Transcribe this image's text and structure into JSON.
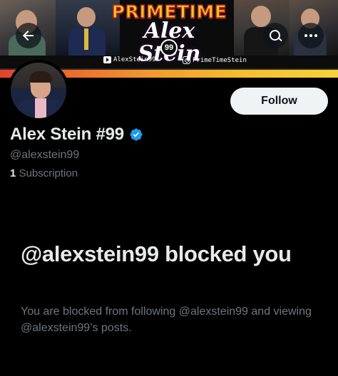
{
  "banner": {
    "logo_top": "PRIMETIME",
    "logo_script": "Alex Stein",
    "logo_badge": "99",
    "youtube_handle": "AlexStein99",
    "instagram_handle": "PrimeTimeStein"
  },
  "nav": {
    "back_icon": "arrow-left-icon",
    "search_icon": "search-icon",
    "more_icon": "more-horizontal-icon"
  },
  "profile": {
    "display_name": "Alex Stein #99",
    "verified_color": "#1d9bf0",
    "handle": "@alexstein99",
    "subscription_count": "1",
    "subscription_label": "Subscription",
    "follow_label": "Follow"
  },
  "blocked": {
    "title": "@alexstein99 blocked you",
    "description": "You are blocked from following @alexstein99 and viewing @alexstein99’s posts."
  },
  "colors": {
    "background": "#000000",
    "primary_text": "#e7e9ea",
    "secondary_text": "#71767b",
    "follow_button_bg": "#eff3f4",
    "accent": "#1d9bf0"
  }
}
